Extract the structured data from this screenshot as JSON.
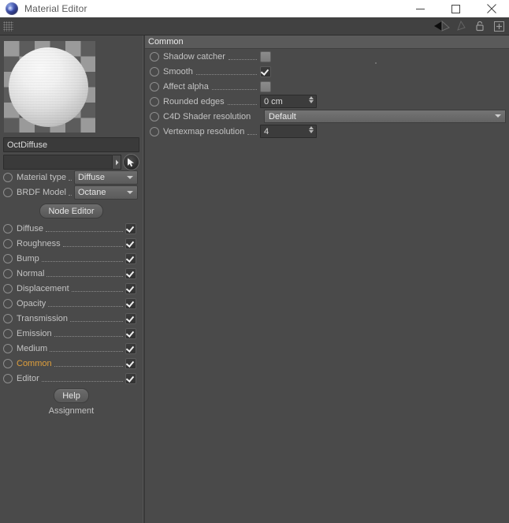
{
  "window": {
    "title": "Material Editor",
    "icon": "c4d-logo-icon",
    "minimize_label": "—",
    "maximize_label": "☐",
    "close_label": "✕"
  },
  "toolbar": {
    "grip": "drag-grip",
    "icons": [
      "back-arrow-icon",
      "forward-arrow-icon",
      "lock-icon",
      "add-panel-icon"
    ]
  },
  "left": {
    "preview_alt": "material-preview-sphere",
    "material_name": "OctDiffuse",
    "search_value": "",
    "material_type": {
      "label": "Material type",
      "value": "Diffuse"
    },
    "brdf_model": {
      "label": "BRDF Model",
      "value": "Octane"
    },
    "node_editor_label": "Node Editor",
    "channels": [
      {
        "label": "Diffuse",
        "checked": true,
        "selected": false
      },
      {
        "label": "Roughness",
        "checked": true,
        "selected": false
      },
      {
        "label": "Bump",
        "checked": true,
        "selected": false
      },
      {
        "label": "Normal",
        "checked": true,
        "selected": false
      },
      {
        "label": "Displacement",
        "checked": true,
        "selected": false
      },
      {
        "label": "Opacity",
        "checked": true,
        "selected": false
      },
      {
        "label": "Transmission",
        "checked": true,
        "selected": false
      },
      {
        "label": "Emission",
        "checked": true,
        "selected": false
      },
      {
        "label": "Medium",
        "checked": true,
        "selected": false
      },
      {
        "label": "Common",
        "checked": true,
        "selected": true
      },
      {
        "label": "Editor",
        "checked": true,
        "selected": false
      }
    ],
    "help_label": "Help",
    "assignment_label": "Assignment"
  },
  "right": {
    "group_title": "Common",
    "rows": [
      {
        "label": "Shadow catcher",
        "type": "checkbox",
        "checked": false
      },
      {
        "label": "Smooth",
        "type": "checkbox",
        "checked": true
      },
      {
        "label": "Affect alpha",
        "type": "checkbox",
        "checked": false
      },
      {
        "label": "Rounded edges",
        "type": "spinner",
        "value": "0 cm"
      },
      {
        "label": "C4D Shader resolution",
        "type": "dropdown",
        "value": "Default"
      },
      {
        "label": "Vertexmap resolution",
        "type": "spinner",
        "value": "4"
      }
    ]
  },
  "colors": {
    "accent": "#e0a03c",
    "panel_bg": "#4a4a4a",
    "header_bg": "#5a5a5a",
    "titlebar_bg": "#ffffff"
  }
}
